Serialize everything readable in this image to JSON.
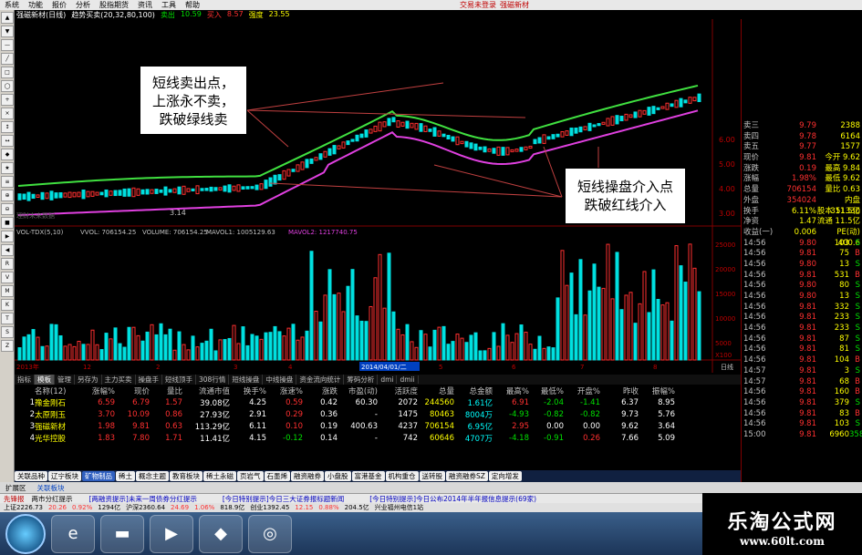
{
  "menu": {
    "items": [
      "系统",
      "功能",
      "报价",
      "分析",
      "股指期货",
      "资讯",
      "工具",
      "帮助"
    ],
    "login": "交易未登录",
    "stock": "强磁新材"
  },
  "chart_title": {
    "name": "强磁新材(日线)",
    "indicator": "趋势买卖(20,32,80,100)",
    "sell_label": "卖出",
    "sell_val": "10.59",
    "buy_label": "买入",
    "buy_val": "8.57",
    "strong_label": "强度",
    "strong_val": "23.55"
  },
  "price_axis": [
    "6.00",
    "5.00",
    "4.00",
    "3.00"
  ],
  "low_label": "3.14",
  "watermark": "理财未来数据",
  "volume_title": {
    "name": "VOL-TDX(5,10)",
    "vvol": "VVOL: 706154.25",
    "volume": "VOLUME: 706154.25",
    "mavol1": "MAVOL1: 1005129.63",
    "mavol2": "MAVOL2: 1217740.75"
  },
  "volume_axis": [
    "25000",
    "20000",
    "15000",
    "10000",
    "5000",
    "X100"
  ],
  "date_axis": {
    "labels": [
      "2013年",
      "12",
      "2",
      "3",
      "4",
      "5",
      "6",
      "7",
      "8"
    ],
    "cursor": "2014/04/01/二",
    "right": "日线"
  },
  "notes": {
    "left": [
      "短线卖出点，",
      "上涨永不卖，",
      "跌破绿线卖"
    ],
    "right": [
      "短线操盘介入点",
      "跌破红线介入"
    ]
  },
  "right_panel": {
    "quotes": [
      {
        "l": "卖三",
        "m": "9.79",
        "r": "2388",
        "mc": "red"
      },
      {
        "l": "卖四",
        "m": "9.78",
        "r": "6164",
        "mc": "red"
      },
      {
        "l": "卖五",
        "m": "9.77",
        "r": "1577",
        "mc": "red"
      }
    ],
    "stats": [
      {
        "l": "现价",
        "m": "9.81",
        "lab": "今开",
        "r": "9.62"
      },
      {
        "l": "涨跌",
        "m": "0.19",
        "lab": "最高",
        "r": "9.84"
      },
      {
        "l": "涨幅",
        "m": "1.98%",
        "lab": "最低",
        "r": "9.62"
      },
      {
        "l": "总量",
        "m": "706154",
        "lab": "量比",
        "r": "0.63"
      },
      {
        "l": "外盘",
        "m": "354024",
        "lab": "内盘",
        "r": "351330"
      }
    ],
    "stats2": [
      {
        "l": "换手",
        "m": "6.11%",
        "lab": "股本",
        "r": "11.5亿"
      },
      {
        "l": "净资",
        "m": "1.47",
        "lab": "流通",
        "r": "11.5亿"
      },
      {
        "l": "收益(一)",
        "m": "0.006",
        "lab": "PE(动)",
        "r": "400.6"
      }
    ],
    "ticks": [
      [
        "14:56",
        "9.80",
        "103",
        "S"
      ],
      [
        "14:56",
        "9.81",
        "75",
        "B"
      ],
      [
        "14:56",
        "9.80",
        "13",
        "S"
      ],
      [
        "14:56",
        "9.81",
        "531",
        "B"
      ],
      [
        "14:56",
        "9.80",
        "80",
        "S"
      ],
      [
        "14:56",
        "9.80",
        "13",
        "S"
      ],
      [
        "14:56",
        "9.81",
        "332",
        "S"
      ],
      [
        "14:56",
        "9.81",
        "233",
        "S"
      ],
      [
        "14:56",
        "9.81",
        "233",
        "S"
      ],
      [
        "14:56",
        "9.81",
        "87",
        "S"
      ],
      [
        "14:56",
        "9.81",
        "81",
        "S"
      ],
      [
        "14:56",
        "9.81",
        "104",
        "B"
      ],
      [
        "14:57",
        "9.81",
        "3",
        "S"
      ],
      [
        "14:57",
        "9.81",
        "68",
        "B"
      ],
      [
        "14:56",
        "9.81",
        "160",
        "B"
      ],
      [
        "14:56",
        "9.81",
        "379",
        "S"
      ],
      [
        "14:56",
        "9.81",
        "83",
        "B"
      ],
      [
        "14:56",
        "9.81",
        "103",
        "S"
      ],
      [
        "15:00",
        "9.81",
        "6960",
        "358"
      ]
    ]
  },
  "tabs": [
    "指标",
    "模板",
    "管理",
    "另存为",
    "主力买卖",
    "操盘手",
    "短线顶手",
    "308行情",
    "短线操盘",
    "中线操盘",
    "资金流向统计",
    "筹码分析",
    "dmi",
    "dmii"
  ],
  "table": {
    "headers": [
      "名称(12)",
      "涨幅%",
      "现价",
      "量比",
      "流通市值",
      "换手%",
      "涨速%",
      "涨跌",
      "市盈(动)",
      "活跃度",
      "总量",
      "总金额",
      "最高%",
      "最低%",
      "开盘%",
      "昨收",
      "振幅%"
    ],
    "rows": [
      {
        "idx": "1",
        "name": "豫金刚石",
        "c": [
          "6.59",
          "6.79",
          "1.57",
          "39.08亿",
          "4.25",
          "0.59",
          "0.42",
          "60.30",
          "2072",
          "244560",
          "1.61亿",
          "6.91",
          "-2.04",
          "-1.41",
          "6.37",
          "8.95"
        ]
      },
      {
        "idx": "2",
        "name": "太原刚玉",
        "c": [
          "3.70",
          "10.09",
          "0.86",
          "27.93亿",
          "2.91",
          "0.29",
          "0.36",
          "-",
          "1475",
          "80463",
          "8004万",
          "-4.93",
          "-0.82",
          "-0.82",
          "9.73",
          "5.76"
        ]
      },
      {
        "idx": "3",
        "name": "强磁新材",
        "c": [
          "1.98",
          "9.81",
          "0.63",
          "113.29亿",
          "6.11",
          "0.10",
          "0.19",
          "400.63",
          "4237",
          "706154",
          "6.95亿",
          "2.95",
          "0.00",
          "0.00",
          "9.62",
          "3.64"
        ]
      },
      {
        "idx": "4",
        "name": "光华控股",
        "c": [
          "1.83",
          "7.80",
          "1.71",
          "11.41亿",
          "4.15",
          "-0.12",
          "0.14",
          "-",
          "742",
          "60646",
          "4707万",
          "-4.18",
          "-0.91",
          "0.26",
          "7.66",
          "5.09"
        ]
      }
    ]
  },
  "sectors": [
    "关联品种",
    "辽宁板块",
    "矿物制品",
    "稀土",
    "概念主题",
    "教育板块",
    "稀土永磁",
    "页岩气",
    "石墨烯",
    "融资融券",
    "小盘股",
    "富港基金",
    "机构重仓",
    "送转股",
    "融资融券SZ",
    "定向增发"
  ],
  "status": {
    "left": "扩展区",
    "mid": "关联板块"
  },
  "ticker": [
    "先锋报",
    "两市分红提示",
    "[两融资提示]未来一周债券分红提示",
    "[今日特别提示]今日三大证券报标题新闻",
    "[今日特别提示]今日公布2014年半年报信息提示(69家)"
  ],
  "index_bar": {
    "sh": "上证2226.73",
    "shc": "20.26",
    "shp": "0.92%",
    "shv": "1294亿",
    "sz": "沪深2360.64",
    "szc": "24.69",
    "szp": "1.06%",
    "szv": "818.9亿",
    "cy": "创业1392.45",
    "cyc": "12.15",
    "cyp": "0.88%",
    "cyv": "204.5亿",
    "net": "兴业福州电信1站"
  },
  "brand": {
    "t1": "乐淘公式网",
    "t2": "www.60lt.com"
  },
  "colors": {
    "up": "#ff3030",
    "down": "#00e0e0",
    "green_line": "#40e040",
    "magenta_line": "#e040e0",
    "bg": "#000000"
  }
}
